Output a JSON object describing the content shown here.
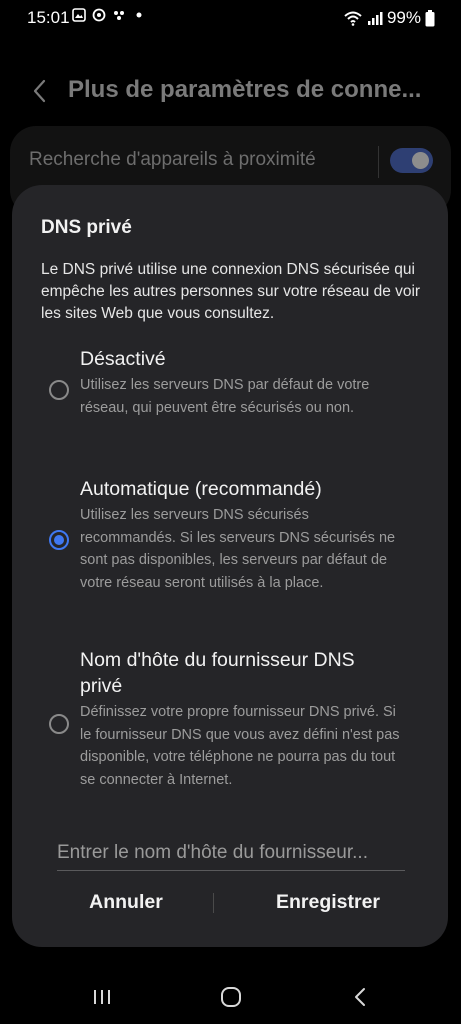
{
  "status_bar": {
    "time": "15:01",
    "battery": "99%",
    "icons": [
      "photo-icon",
      "sync-icon",
      "dots-icon",
      "notification-dot-icon",
      "wifi-icon",
      "signal-icon",
      "battery-icon"
    ]
  },
  "background": {
    "title": "Plus de paramètres de conne...",
    "row_label": "Recherche d'appareils à proximité",
    "toggle_on": true
  },
  "dialog": {
    "title": "DNS privé",
    "description": "Le DNS privé utilise une connexion DNS sécurisée qui empêche les autres personnes sur votre réseau de voir les sites Web que vous consultez.",
    "options": [
      {
        "title": "Désactivé",
        "description": "Utilisez les serveurs DNS par défaut de votre réseau, qui peuvent être sécurisés ou non.",
        "selected": false
      },
      {
        "title": "Automatique (recommandé)",
        "description": "Utilisez les serveurs DNS sécurisés recommandés. Si les serveurs DNS sécurisés ne sont pas disponibles, les serveurs par défaut de votre réseau seront utilisés à la place.",
        "selected": true
      },
      {
        "title": "Nom d'hôte du fournisseur DNS privé",
        "description": "Définissez votre propre fournisseur DNS privé. Si le fournisseur DNS que vous avez défini n'est pas disponible, votre téléphone ne pourra pas du tout se connecter à Internet.",
        "selected": false
      }
    ],
    "hostname_input": {
      "value": "",
      "placeholder": "Entrer le nom d'hôte du fournisseur..."
    },
    "cancel_label": "Annuler",
    "save_label": "Enregistrer"
  },
  "colors": {
    "accent": "#3f78f2",
    "dialog_bg": "#252528",
    "secondary_text": "#9c9c9c"
  },
  "nav_bar": [
    "recents-icon",
    "home-icon",
    "back-icon"
  ]
}
